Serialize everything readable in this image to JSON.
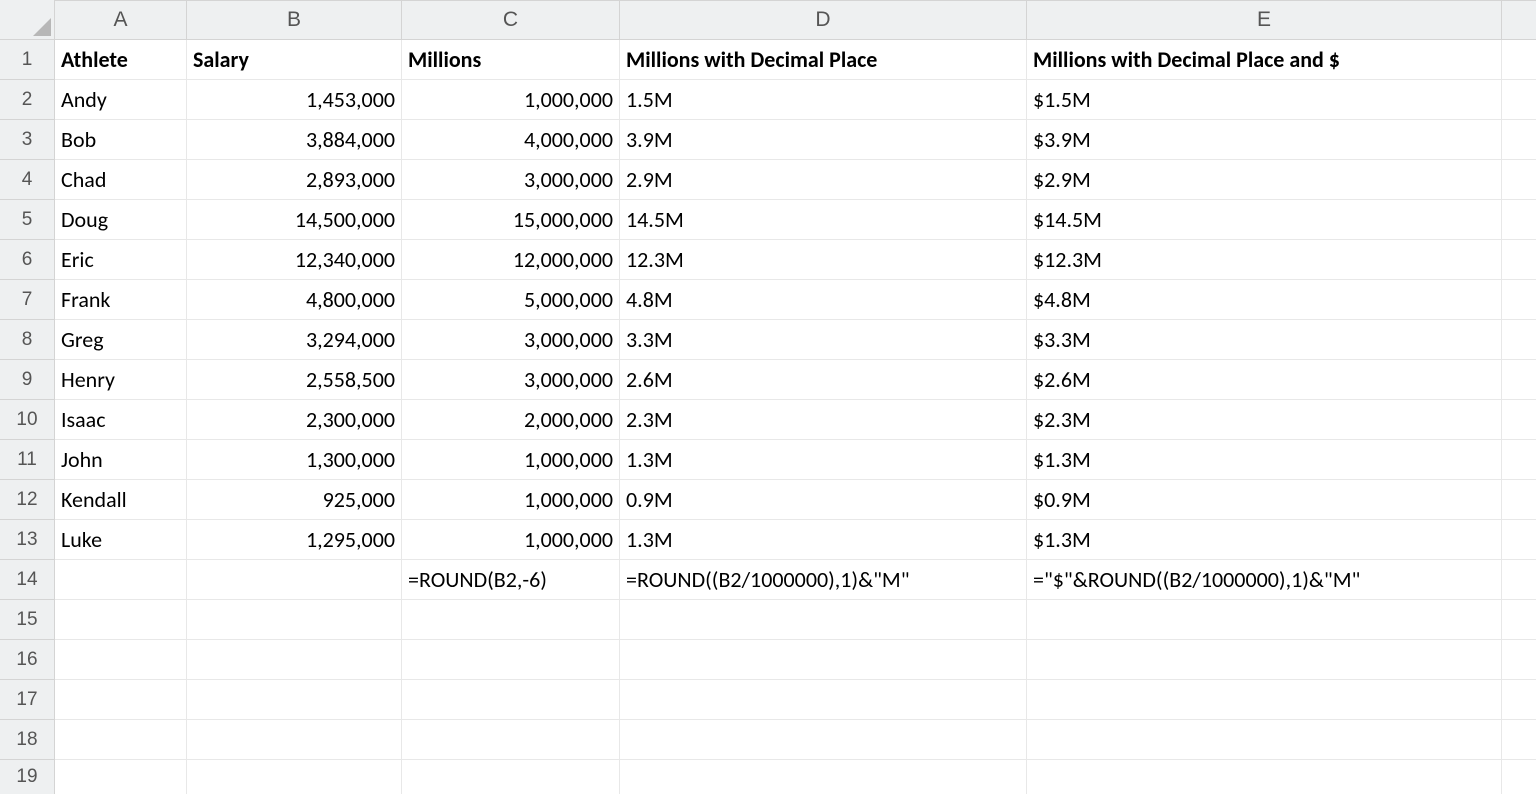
{
  "columns": [
    "A",
    "B",
    "C",
    "D",
    "E"
  ],
  "row_count": 19,
  "headers": {
    "A": "Athlete",
    "B": "Salary",
    "C": "Millions",
    "D": "Millions with Decimal Place",
    "E": "Millions with Decimal Place and $"
  },
  "rows": [
    {
      "n": 2,
      "A": "Andy",
      "B": "1,453,000",
      "C": "1,000,000",
      "D": "1.5M",
      "E": "$1.5M"
    },
    {
      "n": 3,
      "A": "Bob",
      "B": "3,884,000",
      "C": "4,000,000",
      "D": "3.9M",
      "E": "$3.9M"
    },
    {
      "n": 4,
      "A": "Chad",
      "B": "2,893,000",
      "C": "3,000,000",
      "D": "2.9M",
      "E": "$2.9M"
    },
    {
      "n": 5,
      "A": "Doug",
      "B": "14,500,000",
      "C": "15,000,000",
      "D": "14.5M",
      "E": "$14.5M"
    },
    {
      "n": 6,
      "A": "Eric",
      "B": "12,340,000",
      "C": "12,000,000",
      "D": "12.3M",
      "E": "$12.3M"
    },
    {
      "n": 7,
      "A": "Frank",
      "B": "4,800,000",
      "C": "5,000,000",
      "D": "4.8M",
      "E": "$4.8M"
    },
    {
      "n": 8,
      "A": "Greg",
      "B": "3,294,000",
      "C": "3,000,000",
      "D": "3.3M",
      "E": "$3.3M"
    },
    {
      "n": 9,
      "A": "Henry",
      "B": "2,558,500",
      "C": "3,000,000",
      "D": "2.6M",
      "E": "$2.6M"
    },
    {
      "n": 10,
      "A": "Isaac",
      "B": "2,300,000",
      "C": "2,000,000",
      "D": "2.3M",
      "E": "$2.3M"
    },
    {
      "n": 11,
      "A": "John",
      "B": "1,300,000",
      "C": "1,000,000",
      "D": "1.3M",
      "E": "$1.3M"
    },
    {
      "n": 12,
      "A": "Kendall",
      "B": "925,000",
      "C": "1,000,000",
      "D": "0.9M",
      "E": "$0.9M"
    },
    {
      "n": 13,
      "A": "Luke",
      "B": "1,295,000",
      "C": "1,000,000",
      "D": "1.3M",
      "E": "$1.3M"
    }
  ],
  "formulas": {
    "n": 14,
    "C": "=ROUND(B2,-6)",
    "D": "=ROUND((B2/1000000),1)&\"M\"",
    "E": "=\"$\"&ROUND((B2/1000000),1)&\"M\""
  }
}
